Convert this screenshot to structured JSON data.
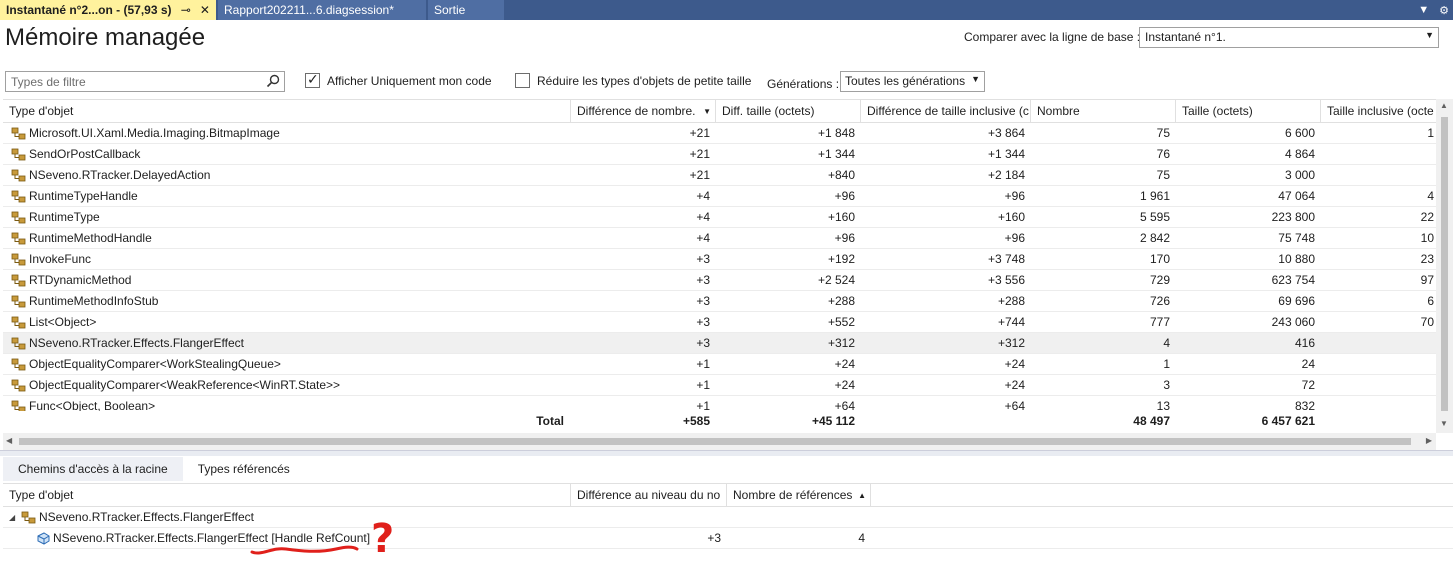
{
  "tabs": [
    {
      "label": "Instantané n°2...on - (57,93 s)",
      "active": true
    },
    {
      "label": "Rapport202211...6.diagsession*",
      "active": false
    },
    {
      "label": "Sortie",
      "active": false
    }
  ],
  "header": {
    "title": "Mémoire managée",
    "baseline_label": "Comparer avec la ligne de base :",
    "baseline_value": "Instantané n°1."
  },
  "filters": {
    "search_placeholder": "Types de filtre",
    "just_my_code_label": "Afficher Uniquement mon code",
    "just_my_code_checked": true,
    "collapse_small_label": "Réduire les types d'objets de petite taille",
    "collapse_small_checked": false,
    "generations_label": "Générations :",
    "generations_value": "Toutes les générations"
  },
  "grid": {
    "columns": [
      "Type d'objet",
      "Différence de nombre.",
      "Diff. taille (octets)",
      "Différence de taille inclusive (c",
      "Nombre",
      "Taille (octets)",
      "Taille inclusive (octe"
    ],
    "rows": [
      [
        "Microsoft.UI.Xaml.Media.Imaging.BitmapImage",
        "+21",
        "+1 848",
        "+3 864",
        "75",
        "6 600",
        "1"
      ],
      [
        "SendOrPostCallback",
        "+21",
        "+1 344",
        "+1 344",
        "76",
        "4 864",
        ""
      ],
      [
        "NSeveno.RTracker.DelayedAction",
        "+21",
        "+840",
        "+2 184",
        "75",
        "3 000",
        ""
      ],
      [
        "RuntimeTypeHandle",
        "+4",
        "+96",
        "+96",
        "1 961",
        "47 064",
        "4"
      ],
      [
        "RuntimeType",
        "+4",
        "+160",
        "+160",
        "5 595",
        "223 800",
        "22"
      ],
      [
        "RuntimeMethodHandle",
        "+4",
        "+96",
        "+96",
        "2 842",
        "75 748",
        "10"
      ],
      [
        "InvokeFunc",
        "+3",
        "+192",
        "+3 748",
        "170",
        "10 880",
        "23"
      ],
      [
        "RTDynamicMethod",
        "+3",
        "+2 524",
        "+3 556",
        "729",
        "623 754",
        "97"
      ],
      [
        "RuntimeMethodInfoStub",
        "+3",
        "+288",
        "+288",
        "726",
        "69 696",
        "6"
      ],
      [
        "List<Object>",
        "+3",
        "+552",
        "+744",
        "777",
        "243 060",
        "70"
      ],
      [
        "NSeveno.RTracker.Effects.FlangerEffect",
        "+3",
        "+312",
        "+312",
        "4",
        "416",
        ""
      ],
      [
        "ObjectEqualityComparer<WorkStealingQueue>",
        "+1",
        "+24",
        "+24",
        "1",
        "24",
        ""
      ],
      [
        "ObjectEqualityComparer<WeakReference<WinRT.State>>",
        "+1",
        "+24",
        "+24",
        "3",
        "72",
        ""
      ],
      [
        "Func<Object, Boolean>",
        "+1",
        "+64",
        "+64",
        "13",
        "832",
        ""
      ]
    ],
    "selected_row": 10,
    "total": {
      "label": "Total",
      "count_diff": "+585",
      "size_diff": "+45 112",
      "count": "48 497",
      "size": "6 457 621"
    }
  },
  "lower_tabs": [
    "Chemins d'accès à la racine",
    "Types référencés"
  ],
  "lower_grid": {
    "columns": [
      "Type d'objet",
      "Différence au niveau du no",
      "Nombre de références"
    ],
    "rows": [
      {
        "name": "NSeveno.RTracker.Effects.FlangerEffect",
        "diff": "",
        "refs": ""
      },
      {
        "name": "NSeveno.RTracker.Effects.FlangerEffect [Handle RefCount]",
        "diff": "+3",
        "refs": "4"
      }
    ]
  },
  "annotation": {
    "mark": "?",
    "color": "#e0201b"
  },
  "colors": {
    "tab_active": "#fff29d",
    "tab_strip": "#3d5a8c",
    "selected_row": "#f0f0f0"
  }
}
